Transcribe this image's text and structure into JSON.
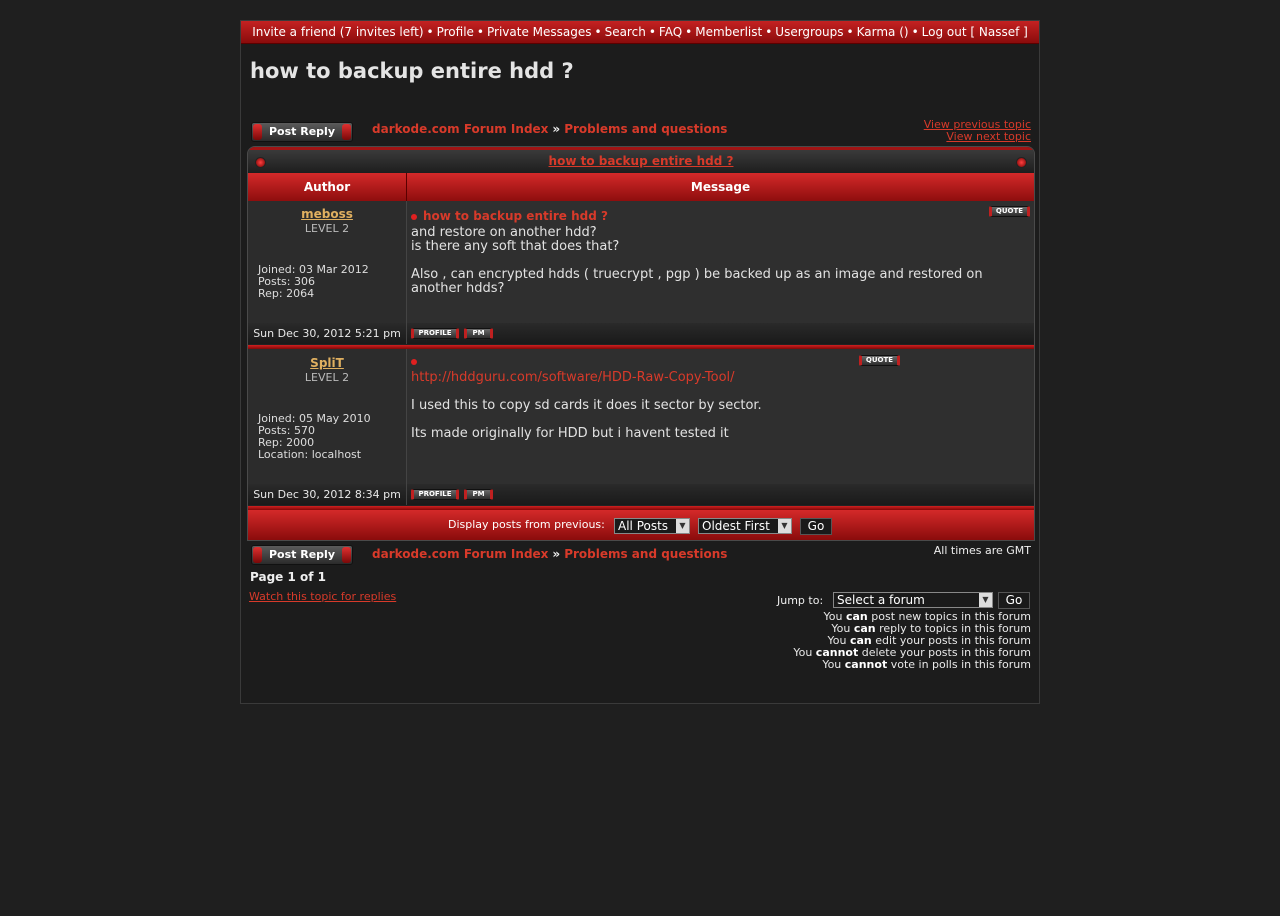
{
  "topnav": {
    "items": [
      "Invite a friend (7 invites left)",
      "Profile",
      "Private Messages",
      "Search",
      "FAQ",
      "Memberlist",
      "Usergroups",
      "Karma ()",
      "Log out [ Nassef ]"
    ],
    "separator": "•"
  },
  "topic": {
    "title": "how to backup entire hdd ?",
    "table_title": "how to backup entire hdd ?"
  },
  "buttons": {
    "post_reply": "Post Reply",
    "quote": "QUOTE",
    "profile": "PROFILE",
    "pm": "PM",
    "go": "Go"
  },
  "breadcrumb": {
    "index": "darkode.com Forum Index",
    "separator": "»",
    "forum": "Problems and questions"
  },
  "topic_nav": {
    "prev": "View previous topic",
    "next": "View next topic"
  },
  "table_headers": {
    "author": "Author",
    "message": "Message"
  },
  "posts": [
    {
      "username": "meboss",
      "level": "LEVEL 2",
      "joined": "Joined: 03 Mar 2012",
      "posts": "Posts: 306",
      "rep": "Rep: 2064",
      "location": "",
      "subject": "how to backup entire hdd ?",
      "lines": [
        "and restore on another hdd?",
        "is there any soft that does that?",
        "",
        "Also , can encrypted hdds ( truecrypt , pgp ) be backed up as an image and restored on another hdds?"
      ],
      "date": "Sun Dec 30, 2012 5:21 pm"
    },
    {
      "username": "SpliT",
      "level": "LEVEL 2",
      "joined": "Joined: 05 May 2010",
      "posts": "Posts: 570",
      "rep": "Rep: 2000",
      "location": "Location: localhost",
      "subject": "",
      "link": "http://hddguru.com/software/HDD-Raw-Copy-Tool/",
      "lines": [
        "I used this to copy sd cards it does it sector by sector.",
        "Its made originally for HDD but i havent tested it"
      ],
      "date": "Sun Dec 30, 2012 8:34 pm"
    }
  ],
  "display": {
    "label": "Display posts from previous:",
    "range_selected": "All Posts",
    "order_selected": "Oldest First"
  },
  "footer": {
    "timezone": "All times are GMT",
    "page": "Page 1 of 1",
    "watch": "Watch this topic for replies",
    "jump_label": "Jump to:",
    "jump_selected": "Select a forum",
    "permissions": [
      {
        "pre": "You ",
        "b": "can",
        "post": " post new topics in this forum"
      },
      {
        "pre": "You ",
        "b": "can",
        "post": " reply to topics in this forum"
      },
      {
        "pre": "You ",
        "b": "can",
        "post": " edit your posts in this forum"
      },
      {
        "pre": "You ",
        "b": "cannot",
        "post": " delete your posts in this forum"
      },
      {
        "pre": "You ",
        "b": "cannot",
        "post": " vote in polls in this forum"
      }
    ]
  },
  "colors": {
    "accent": "#c42222",
    "link": "#d83a2a",
    "background": "#1f1f1f"
  }
}
